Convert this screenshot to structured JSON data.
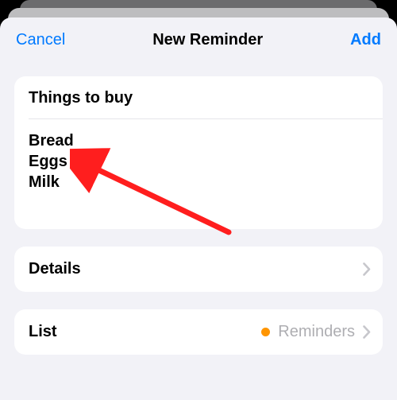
{
  "header": {
    "cancel_label": "Cancel",
    "title": "New Reminder",
    "add_label": "Add"
  },
  "reminder": {
    "title": "Things to buy",
    "notes": "Bread\nEggs\nMilk"
  },
  "rows": {
    "details": {
      "label": "Details"
    },
    "list": {
      "label": "List",
      "selected_name": "Reminders",
      "dot_color": "#ff9500"
    }
  },
  "colors": {
    "accent": "#007aff",
    "sheet_bg": "#f2f2f7",
    "chevron": "#c7c7cc"
  },
  "annotation": {
    "arrow_color": "#ff1e1e",
    "target": "notes-eggs"
  }
}
